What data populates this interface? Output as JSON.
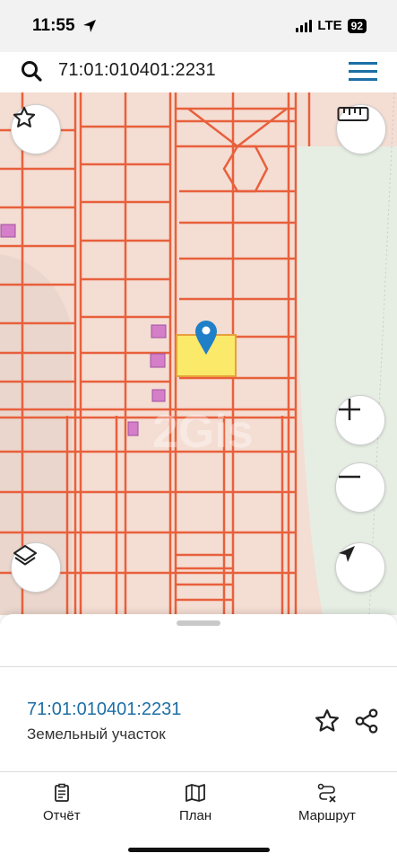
{
  "status_bar": {
    "time": "11:55",
    "network": "LTE",
    "battery": "92"
  },
  "search": {
    "query": "71:01:010401:2231"
  },
  "map": {
    "watermark": "2Gis",
    "buttons": [
      "favorite",
      "ruler",
      "zoom-in",
      "zoom-out",
      "layers",
      "my-location"
    ]
  },
  "parcel": {
    "id": "71:01:010401:2231",
    "type": "Земельный участок"
  },
  "tabs": [
    {
      "label": "Отчёт",
      "icon": "report-icon"
    },
    {
      "label": "План",
      "icon": "map-icon"
    },
    {
      "label": "Маршрут",
      "icon": "route-icon"
    }
  ],
  "colors": {
    "link": "#1d6fa5",
    "parcel_border": "#e8603c",
    "selected_parcel": "#fbe96a",
    "marker": "#1f7fc7",
    "map_background": "#f4ddd3"
  }
}
